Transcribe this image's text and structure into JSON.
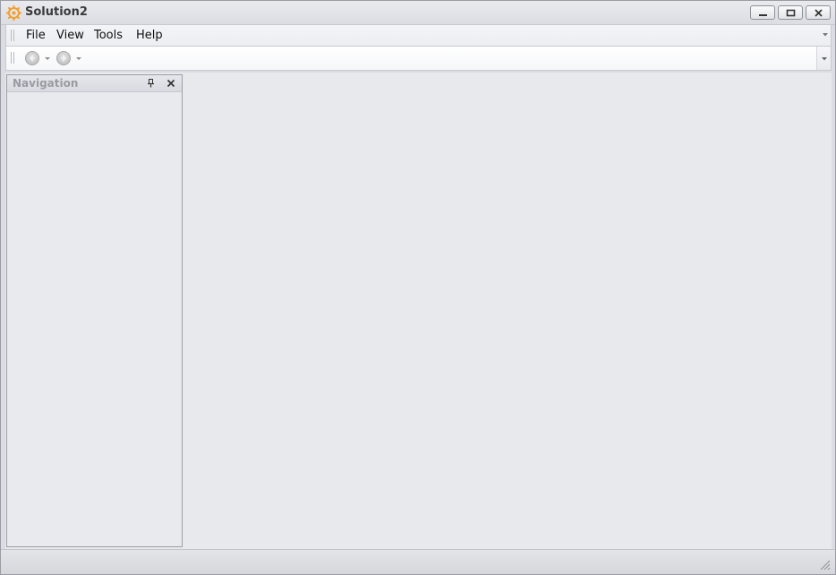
{
  "window": {
    "title": "Solution2"
  },
  "menu": {
    "items": [
      "File",
      "View",
      "Tools",
      "Help"
    ]
  },
  "toolbar": {
    "buttons": [
      {
        "icon": "back-arrow-icon",
        "enabled": false
      },
      {
        "icon": "forward-arrow-icon",
        "enabled": false
      }
    ]
  },
  "navigation_panel": {
    "title": "Navigation"
  },
  "colors": {
    "app_icon": "#f0a030",
    "panel_title": "#9a9ba2",
    "workspace": "#e8e9ed"
  }
}
